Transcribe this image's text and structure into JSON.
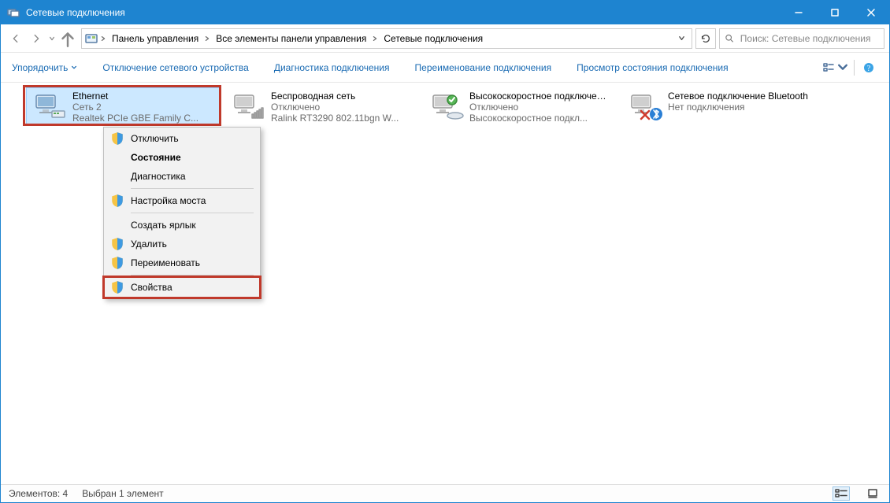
{
  "window": {
    "title": "Сетевые подключения"
  },
  "breadcrumbs": {
    "b0": "Панель управления",
    "b1": "Все элементы панели управления",
    "b2": "Сетевые подключения"
  },
  "search": {
    "placeholder": "Поиск: Сетевые подключения"
  },
  "commands": {
    "organize": "Упорядочить",
    "disable": "Отключение сетевого устройства",
    "diagnose": "Диагностика подключения",
    "rename": "Переименование подключения",
    "status": "Просмотр состояния подключения"
  },
  "connections": {
    "c0": {
      "name": "Ethernet",
      "status": "Сеть  2",
      "device": "Realtek PCIe GBE Family C..."
    },
    "c1": {
      "name": "Беспроводная сеть",
      "status": "Отключено",
      "device": "Ralink RT3290 802.11bgn W..."
    },
    "c2": {
      "name": "Высокоскоростное подключение",
      "status": "Отключено",
      "device": "Высокоскоростное подкл..."
    },
    "c3": {
      "name": "Сетевое подключение Bluetooth",
      "status": "Нет подключения",
      "device": ""
    }
  },
  "context_menu": {
    "disable": "Отключить",
    "state": "Состояние",
    "diag": "Диагностика",
    "bridge": "Настройка моста",
    "shortcut": "Создать ярлык",
    "delete": "Удалить",
    "rename": "Переименовать",
    "props": "Свойства"
  },
  "statusbar": {
    "count_label": "Элементов: 4",
    "sel_label": "Выбран 1 элемент"
  }
}
